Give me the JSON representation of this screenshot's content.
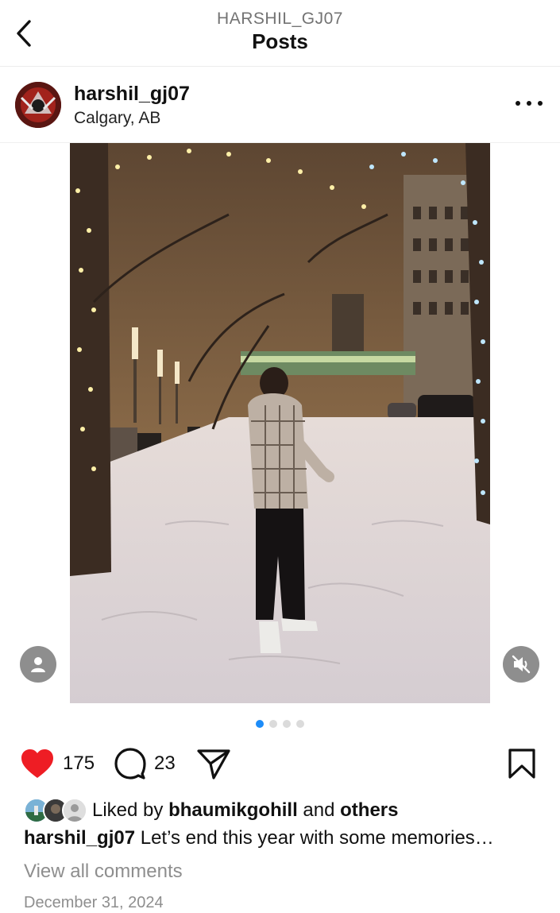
{
  "header": {
    "username_caps": "HARSHIL_GJ07",
    "title": "Posts",
    "back_icon": "chevron-left-icon"
  },
  "post": {
    "author": "harshil_gj07",
    "location": "Calgary, AB",
    "more_icon": "ellipsis-icon",
    "media_description_icons": [
      "person-tag-icon",
      "muted-speaker-icon"
    ],
    "carousel": {
      "count": 4,
      "active_index": 0
    },
    "likes_count": "175",
    "comments_count": "23",
    "liked_by_prefix": "Liked by",
    "liked_by_user": "bhaumikgohill",
    "liked_by_and": "and",
    "liked_by_others": "others",
    "caption_user": "harshil_gj07",
    "caption_text": "Let’s end this year with some memories…",
    "view_all_comments": "View all comments",
    "date": "December 31, 2024"
  },
  "colors": {
    "heart": "#ee1d24",
    "dot_active": "#1d8cf8",
    "muted_text": "#8e8e8e"
  }
}
